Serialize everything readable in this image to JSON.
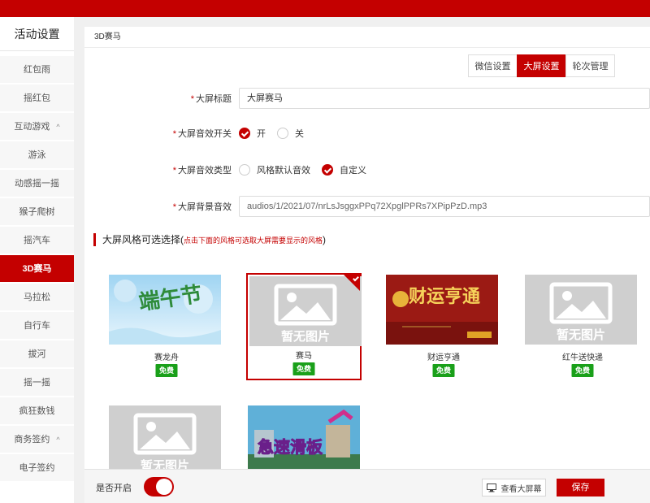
{
  "sidebar": {
    "title": "活动设置",
    "items": [
      {
        "label": "红包雨"
      },
      {
        "label": "摇红包"
      },
      {
        "label": "互动游戏",
        "caret": "^"
      },
      {
        "label": "游泳"
      },
      {
        "label": "动感摇一摇"
      },
      {
        "label": "猴子爬树"
      },
      {
        "label": "摇汽车"
      },
      {
        "label": "3D赛马"
      },
      {
        "label": "马拉松"
      },
      {
        "label": "自行车"
      },
      {
        "label": "拔河"
      },
      {
        "label": "摇一摇"
      },
      {
        "label": "疯狂数钱"
      },
      {
        "label": "商务签约",
        "caret": "^"
      },
      {
        "label": "电子签约"
      }
    ]
  },
  "breadcrumb": "3D赛马",
  "tabs": [
    "微信设置",
    "大屏设置",
    "轮次管理"
  ],
  "form": {
    "title_label": "大屏标题",
    "title_value": "大屏赛马",
    "sound_switch_label": "大屏音效开关",
    "sound_on": "开",
    "sound_off": "关",
    "sound_type_label": "大屏音效类型",
    "sound_type_default": "风格默认音效",
    "sound_type_custom": "自定义",
    "bg_sound_label": "大屏背景音效",
    "bg_sound_value": "audios/1/2021/07/nrLsJsggxPPq72XpglPPRs7XPipPzD.mp3"
  },
  "styles_section": {
    "title": "大屏风格可选选择",
    "paren_open": "(",
    "hint": "点击下面的风格可选取大屏需要显示的风格",
    "paren_close": ")"
  },
  "styles": [
    {
      "name": "赛龙舟",
      "badge": "免费",
      "art": "端午节"
    },
    {
      "name": "赛马",
      "badge": "免费",
      "art": "暂无图片"
    },
    {
      "name": "财运亨通",
      "badge": "免费",
      "art": "财运亨通"
    },
    {
      "name": "红牛送快递",
      "badge": "免费",
      "art": "暂无图片"
    },
    {
      "name": "",
      "badge": "",
      "art": "暂无图片"
    },
    {
      "name": "",
      "badge": "",
      "art": "急速滑板"
    }
  ],
  "bottom": {
    "enable_label": "是否开启",
    "view_label": "查看大屏幕",
    "save_label": "保存"
  },
  "colors": {
    "accent": "#c40000",
    "badge": "#1aa01a"
  }
}
